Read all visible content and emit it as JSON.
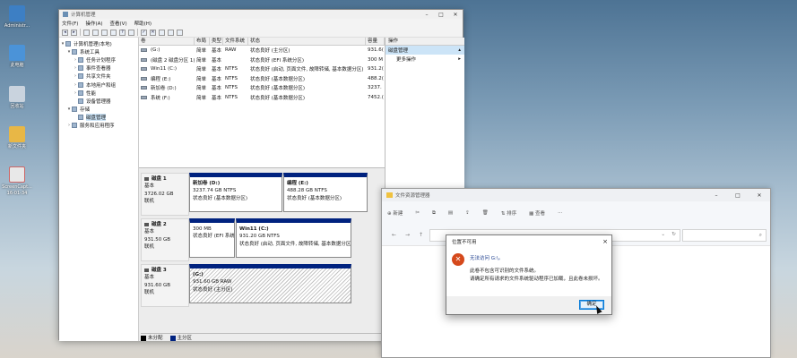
{
  "desktop": {
    "icons": [
      {
        "label": "Administr...",
        "color": "#3d7fc4"
      },
      {
        "label": "此电脑",
        "color": "#4b93d8"
      },
      {
        "label": "回收站",
        "color": "#c9d3de"
      },
      {
        "label": "新文件夹",
        "color": "#e8b746"
      },
      {
        "label": "ScreenCapt... 16-01-34",
        "color": "#e8e8e8"
      }
    ]
  },
  "computer_management": {
    "title": "计算机管理",
    "menu": [
      "文件(F)",
      "操作(A)",
      "查看(V)",
      "帮助(H)"
    ],
    "tree": [
      {
        "label": "计算机管理(本地)",
        "depth": 0,
        "toggle": "▾"
      },
      {
        "label": "系统工具",
        "depth": 1,
        "toggle": "▾"
      },
      {
        "label": "任务计划程序",
        "depth": 2,
        "toggle": "›"
      },
      {
        "label": "事件查看器",
        "depth": 2,
        "toggle": "›"
      },
      {
        "label": "共享文件夹",
        "depth": 2,
        "toggle": "›"
      },
      {
        "label": "本地用户和组",
        "depth": 2,
        "toggle": "›"
      },
      {
        "label": "性能",
        "depth": 2,
        "toggle": "›"
      },
      {
        "label": "设备管理器",
        "depth": 2,
        "toggle": ""
      },
      {
        "label": "存储",
        "depth": 1,
        "toggle": "▾"
      },
      {
        "label": "磁盘管理",
        "depth": 2,
        "toggle": "",
        "selected": true
      },
      {
        "label": "服务和应用程序",
        "depth": 1,
        "toggle": "›"
      }
    ],
    "volume_headers": [
      "卷",
      "布局",
      "类型",
      "文件系统",
      "状态",
      "容量"
    ],
    "volumes": [
      {
        "vol": "(G:)",
        "layout": "简单",
        "type": "基本",
        "fs": "RAW",
        "status": "状态良好 (主分区)",
        "capacity": "931.6("
      },
      {
        "vol": "(磁盘 2 磁盘分区 1)",
        "layout": "简单",
        "type": "基本",
        "fs": "",
        "status": "状态良好 (EFI 系统分区)",
        "capacity": "300 M"
      },
      {
        "vol": "Win11 (C:)",
        "layout": "简单",
        "type": "基本",
        "fs": "NTFS",
        "status": "状态良好 (启动, 页面文件, 故障转储, 基本数据分区)",
        "capacity": "931.2("
      },
      {
        "vol": "编程 (E:)",
        "layout": "简单",
        "type": "基本",
        "fs": "NTFS",
        "status": "状态良好 (基本数据分区)",
        "capacity": "488.2("
      },
      {
        "vol": "新加卷 (D:)",
        "layout": "简单",
        "type": "基本",
        "fs": "NTFS",
        "status": "状态良好 (基本数据分区)",
        "capacity": "3237."
      },
      {
        "vol": "系统 (F:)",
        "layout": "简单",
        "type": "基本",
        "fs": "NTFS",
        "status": "状态良好 (基本数据分区)",
        "capacity": "7452.("
      }
    ],
    "disks": [
      {
        "name": "磁盘 1",
        "kind": "基本",
        "size": "3726.02 GB",
        "state": "联机",
        "partitions": [
          {
            "name": "新加卷 (D:)",
            "size": "3237.74 GB NTFS",
            "status": "状态良好 (基本数据分区)"
          },
          {
            "name": "编程 (E:)",
            "size": "488.28 GB NTFS",
            "status": "状态良好 (基本数据分区)"
          }
        ]
      },
      {
        "name": "磁盘 2",
        "kind": "基本",
        "size": "931.50 GB",
        "state": "联机",
        "partitions": [
          {
            "name": "",
            "size": "300 MB",
            "status": "状态良好 (EFI 系统"
          },
          {
            "name": "Win11 (C:)",
            "size": "931.20 GB NTFS",
            "status": "状态良好 (启动, 页面文件, 故障转储, 基本数据分区"
          }
        ]
      },
      {
        "name": "磁盘 3",
        "kind": "基本",
        "size": "931.60 GB",
        "state": "联机",
        "partitions": [
          {
            "name": "(G:)",
            "size": "931.60 GB RAW",
            "status": "状态良好 (主分区)"
          }
        ]
      }
    ],
    "legend": [
      "未分配",
      "主分区"
    ],
    "actions": {
      "header": "操作",
      "selected": "磁盘管理",
      "more": "更多操作"
    }
  },
  "file_explorer": {
    "title": "文件资源管理器",
    "commands": [
      "新建",
      "✂",
      "⧉",
      "▤",
      "⇪",
      "🗑",
      "排序",
      "查看",
      "···"
    ]
  },
  "dialog": {
    "title": "位置不可用",
    "close": "×",
    "icon_glyph": "✕",
    "message": "无法访问 G:\\。",
    "detail_line1": "此卷不包含可识别的文件系统。",
    "detail_line2": "请确定所有请求的文件系统驱动程序已加载，且此卷未损坏。",
    "ok_label": "确定"
  }
}
